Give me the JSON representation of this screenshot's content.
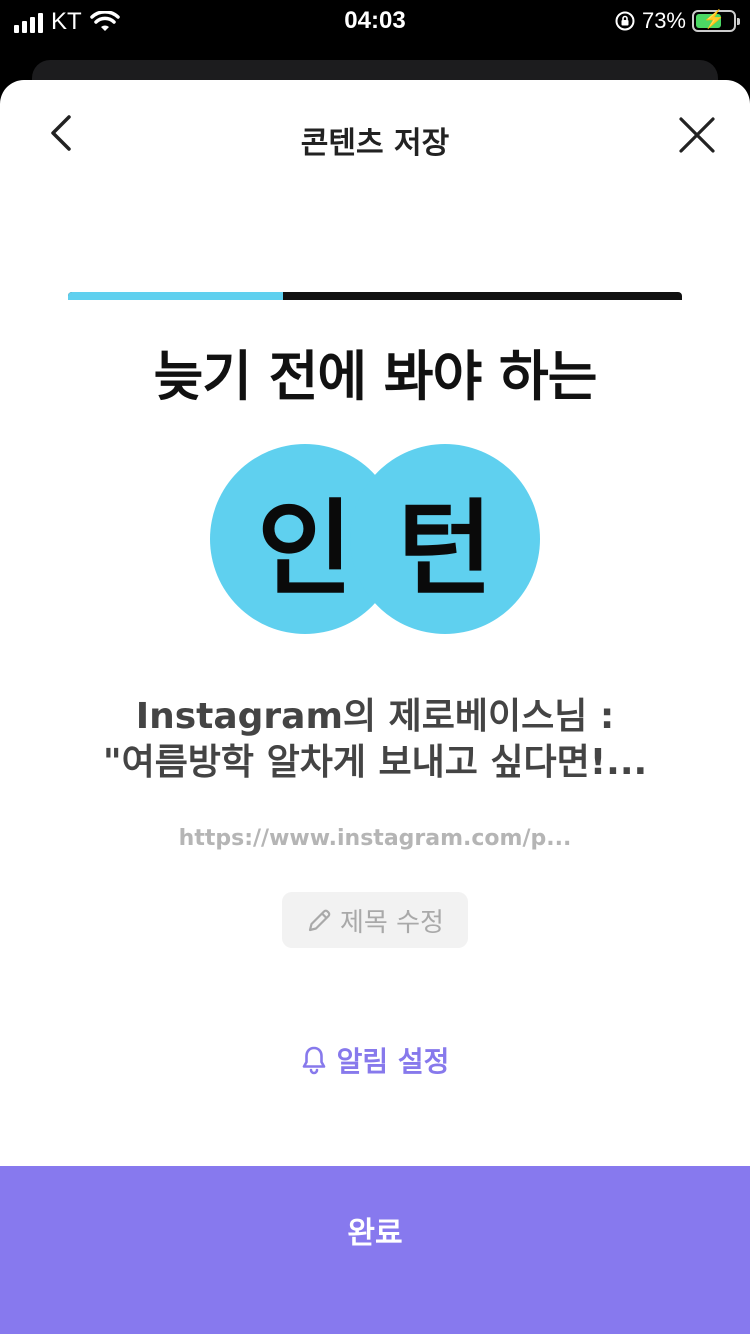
{
  "status_bar": {
    "carrier": "KT",
    "time": "04:03",
    "battery_percent": "73%",
    "battery_level": 0.73
  },
  "header": {
    "title": "콘텐츠 저장",
    "back_icon": "chevron-left-icon",
    "close_icon": "close-icon"
  },
  "thumbnail": {
    "progress": 0.35,
    "headline": "늦기 전에 봐야 하는",
    "circle_left": "인",
    "circle_right": "턴",
    "accent_color": "#5fd0ef"
  },
  "content": {
    "title_line1": "Instagram의 제로베이스님 :",
    "title_line2": "\"여름방학 알차게 보내고 싶다면!...",
    "url": "https://www.instagram.com/p..."
  },
  "edit_title_button": {
    "icon": "pencil-icon",
    "label": "제목 수정"
  },
  "alarm_button": {
    "icon": "bell-icon",
    "label": "알림 설정",
    "color": "#8779ec"
  },
  "done_button": {
    "label": "완료",
    "color": "#8779ee"
  }
}
